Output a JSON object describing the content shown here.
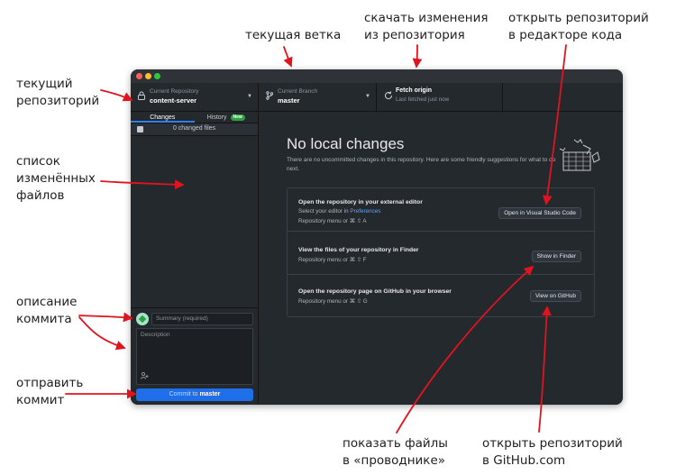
{
  "annotations": {
    "current_repo": [
      "текущий",
      "репозиторий"
    ],
    "current_branch": "текущая ветка",
    "fetch": [
      "скачать изменения",
      "из репозитория"
    ],
    "open_editor": [
      "открыть репозиторий",
      "в редакторе кода"
    ],
    "changed_list": [
      "список",
      "изменённых",
      "файлов"
    ],
    "commit_desc": [
      "описание",
      "коммита"
    ],
    "send_commit": [
      "отправить",
      "коммит"
    ],
    "show_files": [
      "показать файлы",
      "в «проводнике»"
    ],
    "open_github": [
      "открыть репозиторий",
      "в GitHub.com"
    ]
  },
  "toolbar": {
    "repo_label": "Current Repository",
    "repo_name": "content-server",
    "branch_label": "Current Branch",
    "branch_name": "master",
    "fetch_label": "Fetch origin",
    "fetch_sub": "Last fetched just now"
  },
  "sidebar": {
    "tab_changes": "Changes",
    "tab_history": "History",
    "new_badge": "New",
    "changed_files": "0 changed files",
    "summary_placeholder": "Summary (required)",
    "description_placeholder": "Description",
    "commit_prefix": "Commit to",
    "commit_branch": "master"
  },
  "main": {
    "title": "No local changes",
    "subtitle": "There are no uncommitted changes in this repository. Here are some friendly suggestions for what to do next.",
    "cards": [
      {
        "title": "Open the repository in your external editor",
        "line1_prefix": "Select your editor in",
        "line1_link": "Preferences",
        "shortcut": "Repository menu or ⌘ ⇧ A",
        "button": "Open in Visual Studio Code"
      },
      {
        "title": "View the files of your repository in Finder",
        "shortcut": "Repository menu or ⌘ ⇧ F",
        "button": "Show in Finder"
      },
      {
        "title": "Open the repository page on GitHub in your browser",
        "shortcut": "Repository menu or ⌘ ⇧ G",
        "button": "View on GitHub"
      }
    ]
  },
  "colors": {
    "window_bg": "#24292e",
    "accent_blue": "#1f6feb",
    "arrow_red": "#e0141e",
    "link": "#58a6ff"
  }
}
